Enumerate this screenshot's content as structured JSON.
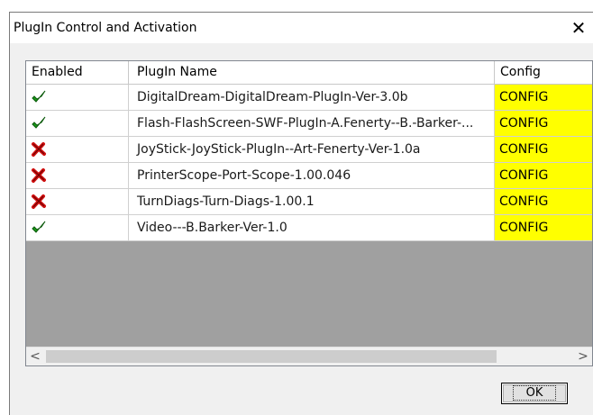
{
  "window": {
    "title": "PlugIn Control and Activation",
    "close_label": "✕"
  },
  "table": {
    "columns": [
      "Enabled",
      "PlugIn Name",
      "Config"
    ],
    "rows": [
      {
        "enabled": true,
        "name": "DigitalDream-DigitalDream-PlugIn-Ver-3.0b",
        "config": "CONFIG"
      },
      {
        "enabled": true,
        "name": "Flash-FlashScreen-SWF-PlugIn-A.Fenerty--B.-Barker-...",
        "config": "CONFIG"
      },
      {
        "enabled": false,
        "name": "JoyStick-JoyStick-PlugIn--Art-Fenerty-Ver-1.0a",
        "config": "CONFIG"
      },
      {
        "enabled": false,
        "name": "PrinterScope-Port-Scope-1.00.046",
        "config": "CONFIG"
      },
      {
        "enabled": false,
        "name": "TurnDiags-Turn-Diags-1.00.1",
        "config": "CONFIG"
      },
      {
        "enabled": true,
        "name": "Video---B.Barker-Ver-1.0",
        "config": "CONFIG"
      }
    ]
  },
  "scrollbar": {
    "left_arrow": "<",
    "right_arrow": ">"
  },
  "buttons": {
    "ok_label": "OK"
  },
  "colors": {
    "config_cell": "#ffff00",
    "enabled_icon": "#1a9a1a",
    "disabled_icon": "#d01010"
  },
  "icons": {
    "enabled": "check-icon",
    "disabled": "x-icon"
  }
}
